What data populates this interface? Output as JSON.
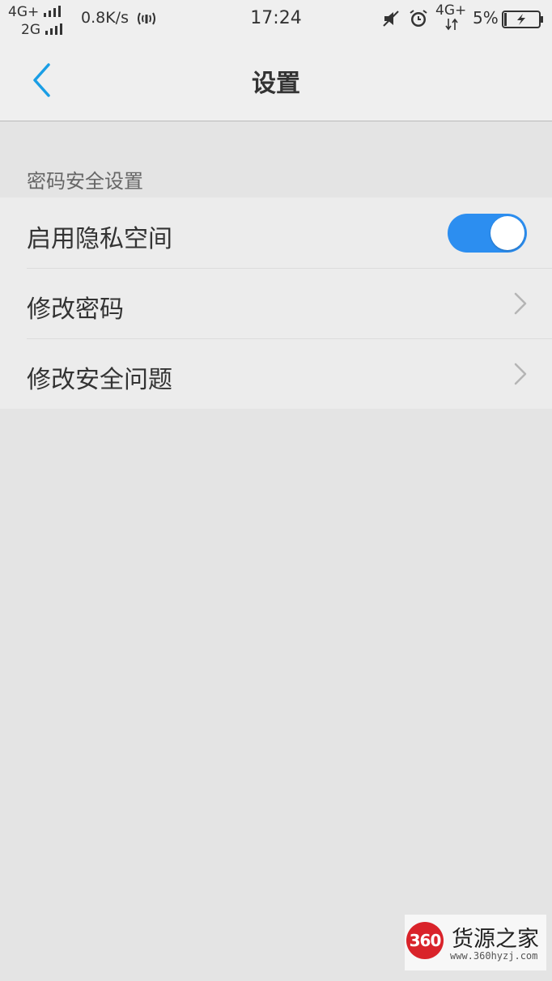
{
  "status_bar": {
    "net1": "4G+",
    "net2": "2G",
    "speed": "0.8K/s",
    "time": "17:24",
    "net3": "4G+",
    "battery_pct": "5%",
    "icons": [
      "signal-bars-icon",
      "hotspot-icon",
      "mute-icon",
      "alarm-icon",
      "data-arrows-icon",
      "battery-charging-icon"
    ]
  },
  "header": {
    "title": "设置",
    "back_icon": "chevron-left-icon"
  },
  "section": {
    "title": "密码安全设置",
    "items": [
      {
        "label": "启用隐私空间",
        "control": "toggle",
        "toggle_on": true
      },
      {
        "label": "修改密码",
        "control": "chevron"
      },
      {
        "label": "修改安全问题",
        "control": "chevron"
      }
    ]
  },
  "watermark": {
    "badge": "360",
    "name": "货源之家",
    "url": "www.360hyzj.com"
  },
  "colors": {
    "accent": "#2c8ef0",
    "back_arrow": "#1a9ee5",
    "background": "#e4e4e4",
    "bar": "#efefef",
    "watermark_red": "#d9232a"
  }
}
